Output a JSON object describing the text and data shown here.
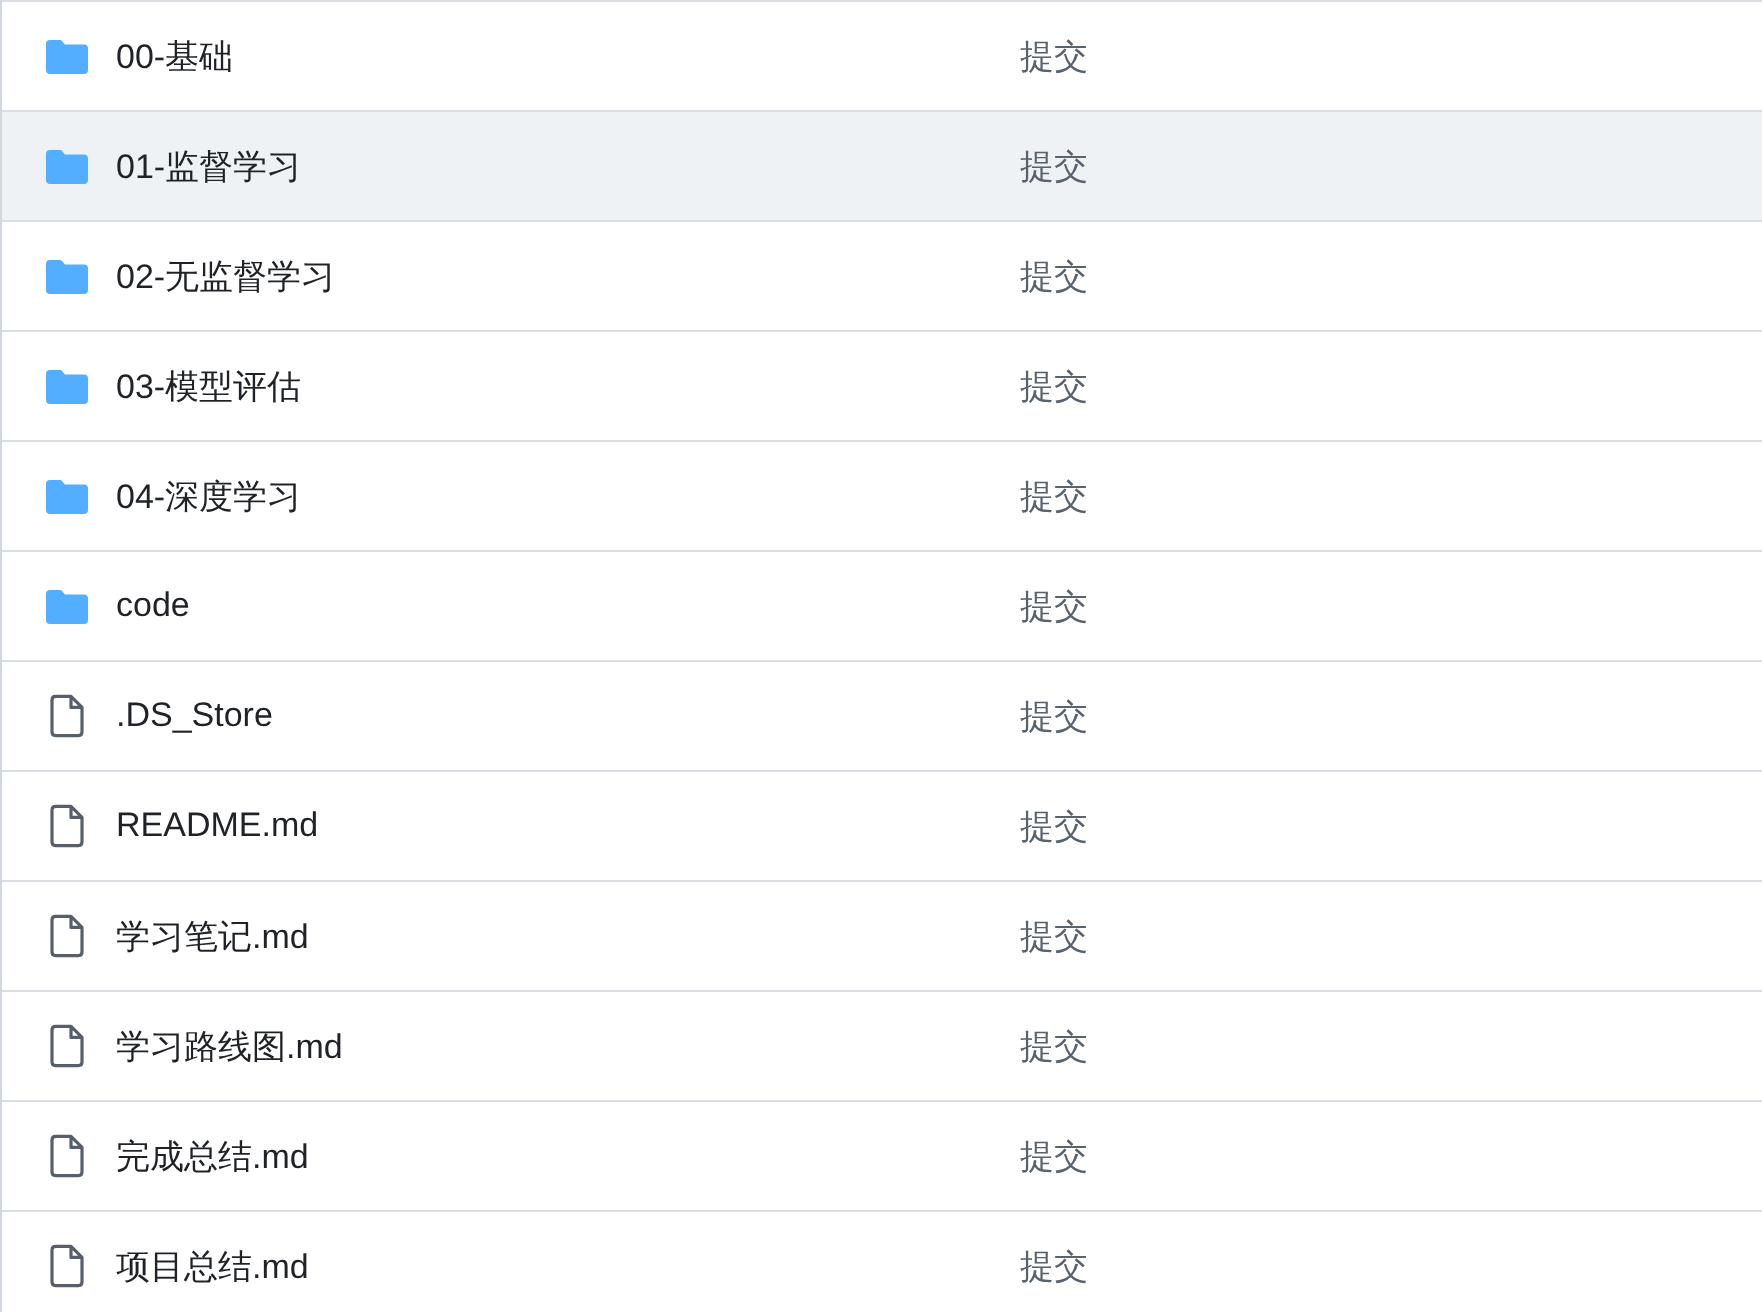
{
  "files": [
    {
      "kind": "folder",
      "name": "00-基础",
      "commit": "提交",
      "selected": false
    },
    {
      "kind": "folder",
      "name": "01-监督学习",
      "commit": "提交",
      "selected": true
    },
    {
      "kind": "folder",
      "name": "02-无监督学习",
      "commit": "提交",
      "selected": false
    },
    {
      "kind": "folder",
      "name": "03-模型评估",
      "commit": "提交",
      "selected": false
    },
    {
      "kind": "folder",
      "name": "04-深度学习",
      "commit": "提交",
      "selected": false
    },
    {
      "kind": "folder",
      "name": "code",
      "commit": "提交",
      "selected": false
    },
    {
      "kind": "file",
      "name": ".DS_Store",
      "commit": "提交",
      "selected": false
    },
    {
      "kind": "file",
      "name": "README.md",
      "commit": "提交",
      "selected": false
    },
    {
      "kind": "file",
      "name": "学习笔记.md",
      "commit": "提交",
      "selected": false
    },
    {
      "kind": "file",
      "name": "学习路线图.md",
      "commit": "提交",
      "selected": false
    },
    {
      "kind": "file",
      "name": "完成总结.md",
      "commit": "提交",
      "selected": false
    },
    {
      "kind": "file",
      "name": "项目总结.md",
      "commit": "提交",
      "selected": false
    }
  ]
}
